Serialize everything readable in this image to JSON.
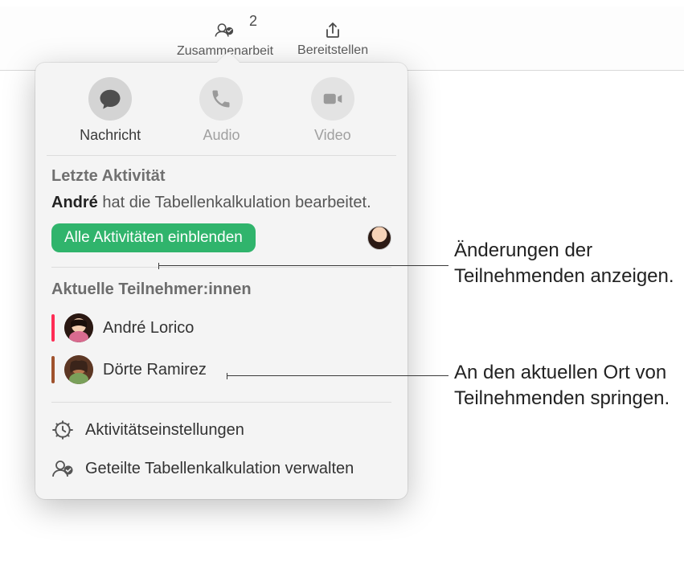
{
  "toolbar": {
    "collaboration": {
      "label": "Zusammenarbeit",
      "badge": "2"
    },
    "share": {
      "label": "Bereitstellen"
    }
  },
  "popover": {
    "comm": {
      "message": "Nachricht",
      "audio": "Audio",
      "video": "Video"
    },
    "activity": {
      "title": "Letzte Aktivität",
      "actor": "André",
      "action": " hat die Tabellenkalkulation bearbeitet.",
      "show_all": "Alle Aktivitäten einblenden"
    },
    "participants": {
      "title": "Aktuelle Teilnehmer:innen",
      "list": [
        {
          "name": "André Lorico",
          "color": "#ff2d55"
        },
        {
          "name": "Dörte Ramirez",
          "color": "#a0522d"
        }
      ]
    },
    "settings": {
      "activity_settings": "Aktivitätseinstellungen",
      "manage_shared": "Geteilte Tabellenkalkulation verwalten"
    }
  },
  "callouts": {
    "changes": "Änderungen der Teilnehmenden anzeigen.",
    "jump": "An den aktuellen Ort von Teilnehmenden springen."
  }
}
